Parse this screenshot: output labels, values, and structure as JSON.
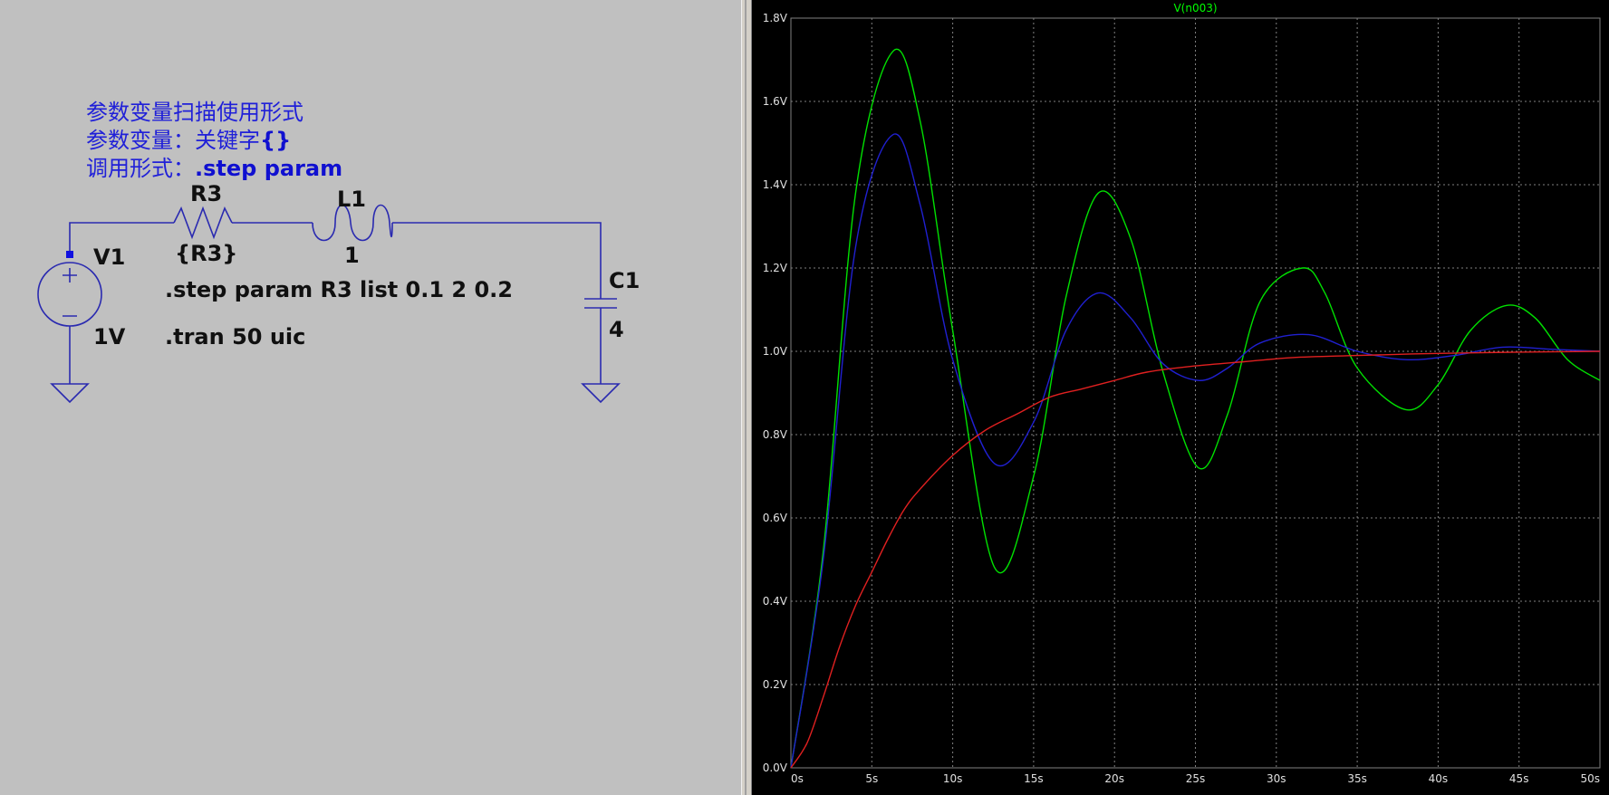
{
  "schematic": {
    "notes": {
      "line1": "参数变量扫描使用形式",
      "line2_prefix": "参数变量：关键字",
      "line2_bold": "{}",
      "line3_prefix": "调用形式：",
      "line3_bold": ".step param"
    },
    "components": {
      "r3_name": "R3",
      "r3_value": "{R3}",
      "l1_name": "L1",
      "l1_value": "1",
      "v1_name": "V1",
      "v1_value": "1V",
      "c1_name": "C1",
      "c1_value": "4"
    },
    "directives": {
      "step": ".step param R3 list 0.1 2 0.2",
      "tran": ".tran 50 uic"
    },
    "colors": {
      "wire": "#2a2ab0",
      "note": "#2020d8",
      "background": "#c0c0c0"
    }
  },
  "waveform": {
    "trace_label": "V(n003)",
    "colors": {
      "background": "#000000",
      "grid": "#808080",
      "axis_text": "#e0e0e0",
      "trace_label": "#00ff00"
    },
    "chart_data": {
      "type": "line",
      "title": "V(n003)",
      "xlim": [
        0,
        50
      ],
      "ylim": [
        0,
        1.8
      ],
      "x_ticks": [
        "0s",
        "5s",
        "10s",
        "15s",
        "20s",
        "25s",
        "30s",
        "35s",
        "40s",
        "45s",
        "50s"
      ],
      "y_ticks": [
        "0.0V",
        "0.2V",
        "0.4V",
        "0.6V",
        "0.8V",
        "1.0V",
        "1.2V",
        "1.4V",
        "1.6V",
        "1.8V"
      ],
      "grid": true,
      "series": [
        {
          "color": "#00e000",
          "x": [
            0,
            2,
            4,
            6.3,
            8,
            10,
            12.6,
            15,
            17,
            19,
            21,
            23,
            25.2,
            27,
            29,
            31.6,
            33,
            35,
            38,
            40,
            42,
            44.2,
            46,
            48,
            50
          ],
          "y": [
            0,
            0.52,
            1.38,
            1.72,
            1.55,
            1.05,
            0.48,
            0.7,
            1.13,
            1.38,
            1.27,
            0.95,
            0.72,
            0.85,
            1.12,
            1.2,
            1.14,
            0.96,
            0.86,
            0.92,
            1.05,
            1.11,
            1.08,
            0.98,
            0.93
          ]
        },
        {
          "color": "#2020d0",
          "x": [
            0,
            2,
            4,
            6.3,
            8,
            10,
            12.6,
            15,
            17,
            19,
            21,
            23,
            25.2,
            27,
            29,
            32,
            35,
            38,
            41,
            44,
            47,
            50
          ],
          "y": [
            0,
            0.5,
            1.25,
            1.52,
            1.35,
            0.98,
            0.73,
            0.83,
            1.05,
            1.14,
            1.08,
            0.97,
            0.93,
            0.96,
            1.02,
            1.04,
            1.0,
            0.98,
            0.99,
            1.01,
            1.005,
            1.0
          ],
          "name": ""
        },
        {
          "color": "#e02020",
          "x": [
            0,
            1,
            2,
            3,
            4,
            5,
            6,
            7,
            8,
            10,
            12,
            14,
            16,
            18,
            20,
            22,
            25,
            28,
            31,
            35,
            40,
            45,
            50
          ],
          "y": [
            0,
            0.06,
            0.17,
            0.29,
            0.39,
            0.47,
            0.55,
            0.62,
            0.67,
            0.75,
            0.81,
            0.85,
            0.89,
            0.91,
            0.93,
            0.95,
            0.965,
            0.975,
            0.985,
            0.99,
            0.995,
            0.998,
            1.0
          ]
        }
      ]
    }
  }
}
